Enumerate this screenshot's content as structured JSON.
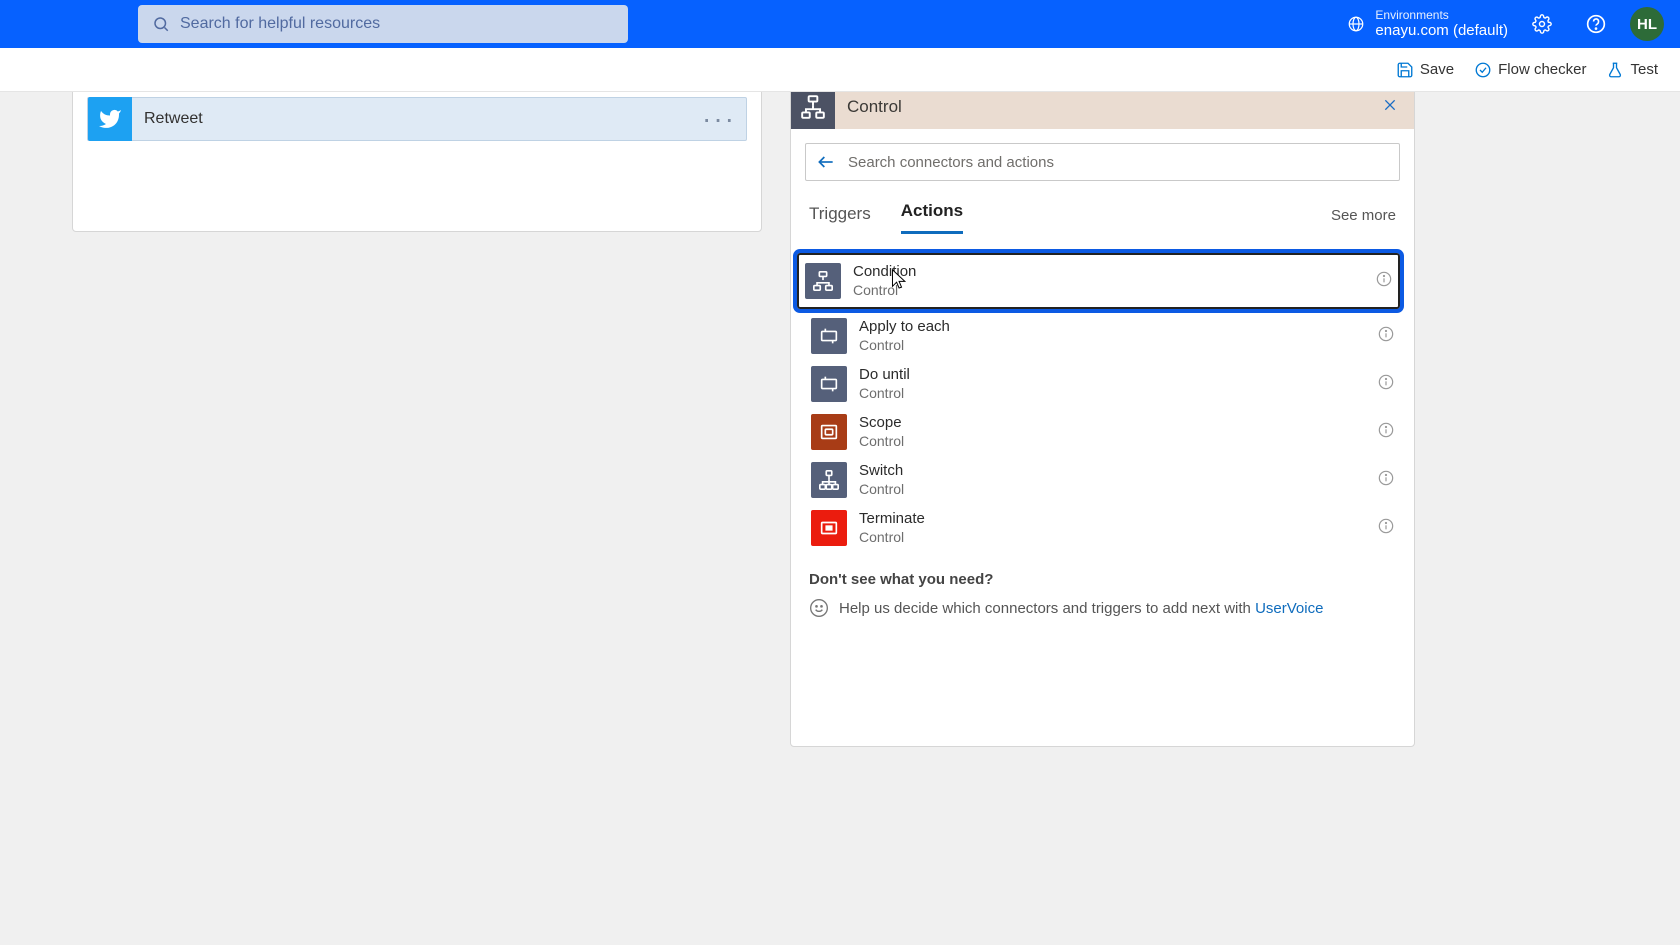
{
  "header": {
    "search_placeholder": "Search for helpful resources",
    "env_label": "Environments",
    "env_name": "enayu.com (default)",
    "avatar": "HL"
  },
  "toolbar": {
    "save": "Save",
    "flow_checker": "Flow checker",
    "test": "Test"
  },
  "left": {
    "title": "Retweet"
  },
  "panel": {
    "header": "Control",
    "search_placeholder": "Search connectors and actions",
    "tab_triggers": "Triggers",
    "tab_actions": "Actions",
    "see_more": "See more",
    "actions": [
      {
        "title": "Condition",
        "sub": "Control",
        "icon": "condition",
        "highlight": true
      },
      {
        "title": "Apply to each",
        "sub": "Control",
        "icon": "loop"
      },
      {
        "title": "Do until",
        "sub": "Control",
        "icon": "loop"
      },
      {
        "title": "Scope",
        "sub": "Control",
        "icon": "scope"
      },
      {
        "title": "Switch",
        "sub": "Control",
        "icon": "switch"
      },
      {
        "title": "Terminate",
        "sub": "Control",
        "icon": "terminate"
      }
    ],
    "help_title": "Don't see what you need?",
    "help_text": "Help us decide which connectors and triggers to add next with ",
    "help_link": "UserVoice"
  }
}
